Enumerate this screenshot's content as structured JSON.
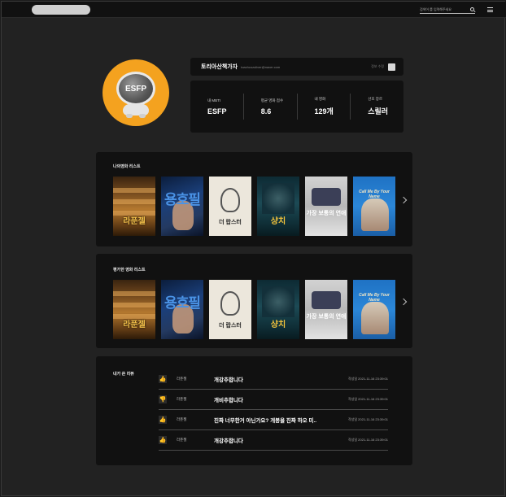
{
  "header": {
    "search_placeholder": "검색어 를 입력해주세요"
  },
  "profile": {
    "avatar_text": "ESFP",
    "nickname": "토리아산책가자",
    "email": "toachcozuliver@naver.com",
    "edit_label": "정보 수정",
    "stats": [
      {
        "label": "내 MBTI",
        "value": "ESFP"
      },
      {
        "label": "평균 영화 점수",
        "value": "8.6"
      },
      {
        "label": "내 영화",
        "value": "129개"
      },
      {
        "label": "선호 장르",
        "value": "스릴러"
      }
    ]
  },
  "my_movies": {
    "title": "나의영화 리스트",
    "posters": [
      {
        "title": "라푼젤"
      },
      {
        "title": "용호필"
      },
      {
        "title": "더 랍스터"
      },
      {
        "title": "샹치"
      },
      {
        "title": "가장 보통의 연애"
      },
      {
        "title": "Call Me By Your Name"
      }
    ]
  },
  "rated_movies": {
    "title": "평가한 영화 리스트",
    "posters": [
      {
        "title": "라푼젤"
      },
      {
        "title": "용호필"
      },
      {
        "title": "더 랍스터"
      },
      {
        "title": "샹치"
      },
      {
        "title": "가장 보통의 연애"
      },
      {
        "title": "Call Me By Your Name"
      }
    ]
  },
  "reviews": {
    "title": "내가 쓴 리뷰",
    "items": [
      {
        "icon": "thumbs-up-icon",
        "movie": "라푼젤",
        "text": "개강추합니다",
        "date": "작성일 2021-11-16 23:39:01"
      },
      {
        "icon": "thumbs-down-icon",
        "movie": "라푼젤",
        "text": "개비추합니다",
        "date": "작성일 2021-11-16 23:39:01"
      },
      {
        "icon": "thumbs-up-icon",
        "movie": "라푼젤",
        "text": "진짜 너무한거 아닌가요? 개봉을 진짜 하오 미..",
        "date": "작성일 2021-11-16 23:39:01"
      },
      {
        "icon": "thumbs-up-icon",
        "movie": "라푼젤",
        "text": "개강추합니다",
        "date": "작성일 2021-11-16 23:39:01"
      }
    ]
  },
  "colors": {
    "accent": "#f4a21f",
    "panel": "#111111",
    "background": "#222222"
  }
}
